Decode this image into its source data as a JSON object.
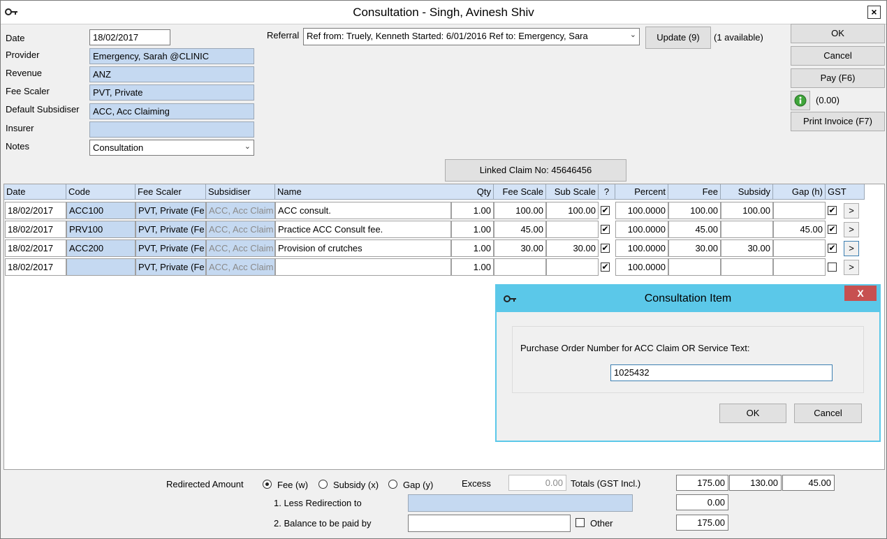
{
  "window": {
    "title": "Consultation - Singh, Avinesh Shiv",
    "close_label": "×"
  },
  "form": {
    "date_label": "Date",
    "date_value": "18/02/2017",
    "provider_label": "Provider",
    "provider_value": "Emergency, Sarah @CLINIC",
    "revenue_label": "Revenue",
    "revenue_value": "ANZ",
    "fee_scaler_label": "Fee Scaler",
    "fee_scaler_value": "PVT, Private",
    "subsidiser_label": "Default Subsidiser",
    "subsidiser_value": "ACC, Acc Claiming",
    "insurer_label": "Insurer",
    "insurer_value": "",
    "notes_label": "Notes",
    "notes_value": "Consultation",
    "referral_label": "Referral",
    "referral_value": "Ref from: Truely, Kenneth Started: 6/01/2016 Ref to: Emergency, Sara",
    "update_label": "Update (9)",
    "available_text": "(1 available)",
    "linked_claim_label": "Linked Claim No: 45646456"
  },
  "actions": {
    "ok_label": "OK",
    "cancel_label": "Cancel",
    "pay_label": "Pay (F6)",
    "balance_text": "(0.00)",
    "print_label": "Print Invoice (F7)"
  },
  "grid": {
    "headers": [
      "Date",
      "Code",
      "Fee Scaler",
      "Subsidiser",
      "Name",
      "Qty",
      "Fee Scale",
      "Sub Scale",
      "?",
      "Percent",
      "Fee",
      "Subsidy",
      "Gap (h)",
      "GST"
    ],
    "rows": [
      {
        "date": "18/02/2017",
        "code": "ACC100",
        "fee_scaler": "PVT, Private (Fe",
        "subsidiser": "ACC, Acc Claim",
        "name": "ACC consult.",
        "qty": "1.00",
        "fee_scale": "100.00",
        "sub_scale": "100.00",
        "q": "✔",
        "percent": "100.0000",
        "fee": "100.00",
        "subsidy": "100.00",
        "gap": "",
        "gst": "✔",
        "more": ">"
      },
      {
        "date": "18/02/2017",
        "code": "PRV100",
        "fee_scaler": "PVT, Private (Fe",
        "subsidiser": "ACC, Acc Claim",
        "name": "Practice ACC Consult fee.",
        "qty": "1.00",
        "fee_scale": "45.00",
        "sub_scale": "",
        "q": "✔",
        "percent": "100.0000",
        "fee": "45.00",
        "subsidy": "",
        "gap": "45.00",
        "gst": "✔",
        "more": ">"
      },
      {
        "date": "18/02/2017",
        "code": "ACC200",
        "fee_scaler": "PVT, Private (Fe",
        "subsidiser": "ACC, Acc Claim",
        "name": "Provision of crutches",
        "qty": "1.00",
        "fee_scale": "30.00",
        "sub_scale": "30.00",
        "q": "✔",
        "percent": "100.0000",
        "fee": "30.00",
        "subsidy": "30.00",
        "gap": "",
        "gst": "✔",
        "more": ">"
      },
      {
        "date": "18/02/2017",
        "code": "",
        "fee_scaler": "PVT, Private (Fe",
        "subsidiser": "ACC, Acc Claim",
        "name": "",
        "qty": "1.00",
        "fee_scale": "",
        "sub_scale": "",
        "q": "✔",
        "percent": "100.0000",
        "fee": "",
        "subsidy": "",
        "gap": "",
        "gst": "",
        "more": ">"
      }
    ]
  },
  "dialog": {
    "title": "Consultation Item",
    "close_label": "X",
    "prompt": "Purchase Order Number for ACC Claim OR Service Text:",
    "input_value": "1025432",
    "ok_label": "OK",
    "cancel_label": "Cancel"
  },
  "footer": {
    "redirected_label": "Redirected Amount",
    "fee_option": "Fee (w)",
    "subsidy_option": "Subsidy (x)",
    "gap_option": "Gap (y)",
    "excess_label": "Excess",
    "excess_value": "0.00",
    "totals_label": "Totals (GST Incl.)",
    "total_fee": "175.00",
    "total_subsidy": "130.00",
    "total_gap": "45.00",
    "less_redirection_label": "1. Less Redirection to",
    "less_redirection_value": "",
    "less_redirection_amount": "0.00",
    "balance_label": "2. Balance to be paid by",
    "balance_value": "",
    "other_label": "Other",
    "balance_amount": "175.00"
  }
}
